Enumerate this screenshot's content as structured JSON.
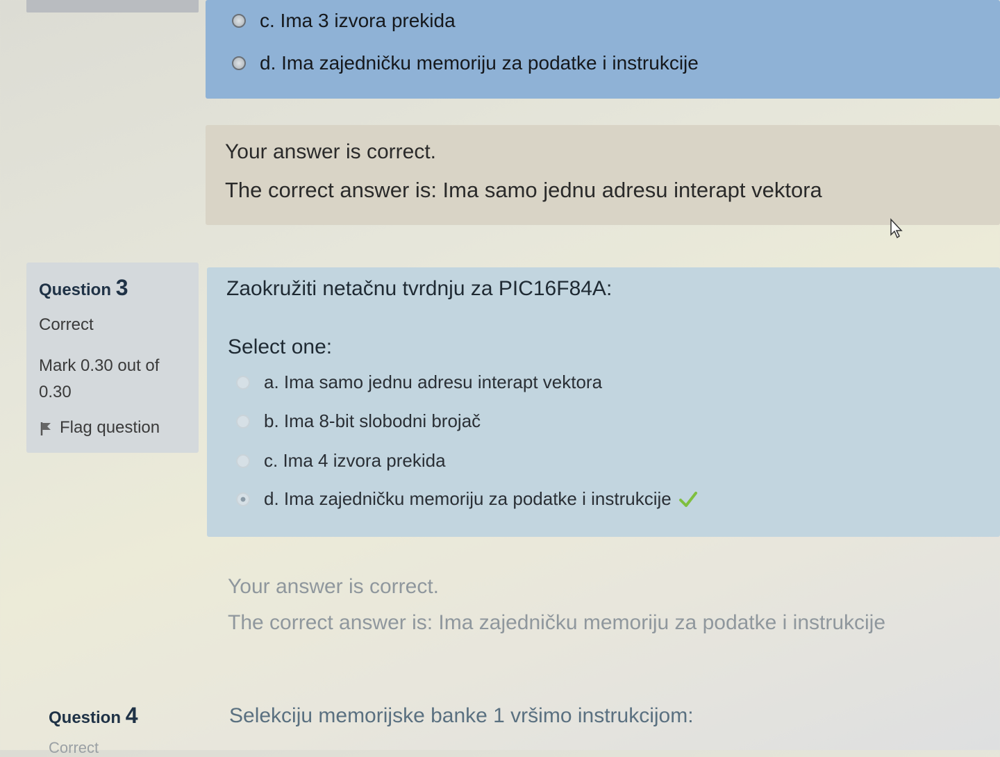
{
  "question2": {
    "options": [
      {
        "label": "c. Ima 3 izvora prekida"
      },
      {
        "label": "d. Ima zajedničku memoriju za podatke i instrukcije"
      }
    ],
    "feedback": {
      "status": "Your answer is correct.",
      "correct_answer": "The correct answer is: Ima samo jednu adresu interapt vektora"
    }
  },
  "question3": {
    "label": "Question",
    "number": "3",
    "state": "Correct",
    "mark": "Mark 0.30 out of 0.30",
    "flag_label": "Flag question",
    "prompt": "Zaokružiti netačnu tvrdnju za PIC16F84A:",
    "select_label": "Select one:",
    "options": [
      {
        "label": "a. Ima samo jednu adresu interapt vektora",
        "selected": false
      },
      {
        "label": "b. Ima 8-bit slobodni brojač",
        "selected": false
      },
      {
        "label": "c. Ima 4 izvora prekida",
        "selected": false
      },
      {
        "label": "d. Ima zajedničku memoriju za podatke i instrukcije",
        "selected": true,
        "correct_mark": "check-icon"
      }
    ],
    "feedback": {
      "status": "Your answer is correct.",
      "correct_answer": "The correct answer is: Ima zajedničku memoriju za podatke i instrukcije"
    }
  },
  "question4": {
    "label": "Question",
    "number": "4",
    "state": "Correct",
    "prompt": "Selekciju memorijske banke 1 vršimo instrukcijom:"
  },
  "colors": {
    "accent_top": "#8fb2d6",
    "formulation": "#c2d5df",
    "feedback_bg": "#d9d4c6",
    "info_bg": "#d4d9dc",
    "check_green": "#7fbf3f",
    "question_label": "#1f3246"
  }
}
